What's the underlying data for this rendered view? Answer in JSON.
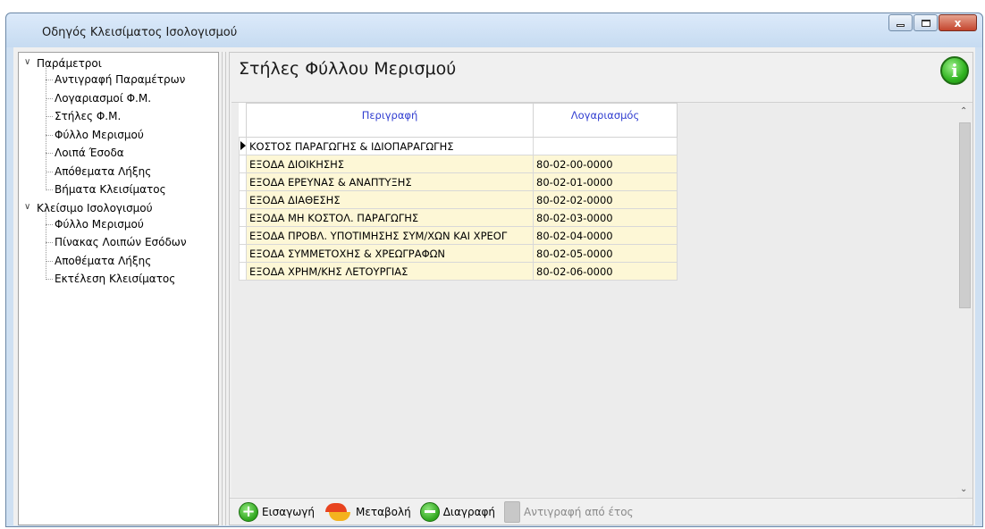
{
  "window": {
    "title": "Οδηγός Κλεισίματος Ισολογισμού",
    "close_label": "x"
  },
  "tree": {
    "groups": [
      {
        "label": "Παράμετροι",
        "items": [
          "Αντιγραφή Παραμέτρων",
          "Λογαριασμοί Φ.Μ.",
          "Στήλες Φ.Μ.",
          "Φύλλο Μερισμού",
          "Λοιπά Έσοδα",
          "Απόθεματα Λήξης",
          "Βήματα Κλεισίματος"
        ]
      },
      {
        "label": "Κλείσιμο Ισολογισμού",
        "items": [
          "Φύλλο Μερισμού",
          "Πίνακας Λοιπών Εσόδων",
          "Αποθέματα Λήξης",
          "Εκτέλεση Κλεισίματος"
        ]
      }
    ]
  },
  "content": {
    "title": "Στήλες Φύλλου Μερισμού",
    "info_glyph": "i"
  },
  "grid": {
    "columns": [
      "Περιγραφή",
      "Λογαριασμός"
    ],
    "rows": [
      {
        "description": "ΚΟΣΤΟΣ ΠΑΡΑΓΩΓΗΣ & ΙΔΙΟΠΑΡΑΓΩΓΗΣ",
        "account": ""
      },
      {
        "description": "ΕΞΟΔΑ ΔΙΟΙΚΗΣΗΣ",
        "account": "80-02-00-0000"
      },
      {
        "description": "ΕΞΟΔΑ ΕΡΕΥΝΑΣ & ΑΝΑΠΤΥΞΗΣ",
        "account": "80-02-01-0000"
      },
      {
        "description": "ΕΞΟΔΑ ΔΙΑΘΕΣΗΣ",
        "account": "80-02-02-0000"
      },
      {
        "description": "ΕΞΟΔΑ ΜΗ ΚΟΣΤΟΛ. ΠΑΡΑΓΩΓΗΣ",
        "account": "80-02-03-0000"
      },
      {
        "description": "ΕΞΟΔΑ ΠΡΟΒΛ. ΥΠΟΤΙΜΗΣΗΣ ΣΥΜ/ΧΩΝ ΚΑΙ ΧΡΕΟΓ",
        "account": "80-02-04-0000"
      },
      {
        "description": "ΕΞΟΔΑ ΣΥΜΜΕΤΟΧΗΣ & ΧΡΕΩΓΡΑΦΩΝ",
        "account": "80-02-05-0000"
      },
      {
        "description": "ΕΞΟΔΑ ΧΡΗΜ/ΚΗΣ ΛΕΤΟΥΡΓΙΑΣ",
        "account": "80-02-06-0000"
      }
    ]
  },
  "toolbar": {
    "insert_label": "Εισαγωγή",
    "modify_label": "Μεταβολή",
    "delete_label": "Διαγραφή",
    "copy_year_label": "Αντιγραφή από έτος"
  },
  "colors": {
    "header_text": "#2f3cd0",
    "alt_row": "#fdf7d6",
    "info_green": "#2fb21f"
  }
}
